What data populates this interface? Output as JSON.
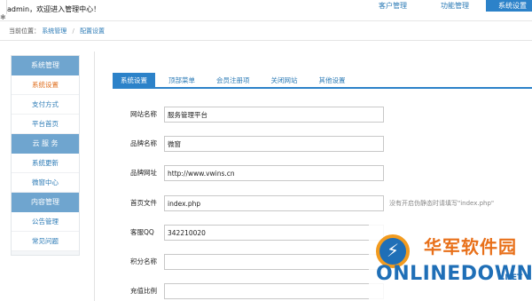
{
  "header": {
    "welcome": "admin，欢迎进入管理中心！",
    "nav": [
      "客户管理",
      "功能管理",
      "系统设置"
    ]
  },
  "breadcrumb": {
    "prefix": "当前位置：",
    "items": [
      "系统管理",
      "配置设置"
    ],
    "sep": "/"
  },
  "sidebar": {
    "sections": [
      {
        "title": "系统管理",
        "items": [
          "系统设置",
          "支付方式",
          "平台首页"
        ]
      },
      {
        "title": "云 服 务",
        "items": [
          "系统更新",
          "微窗中心"
        ]
      },
      {
        "title": "内容管理",
        "items": [
          "公告管理",
          "常见问题"
        ]
      }
    ],
    "active": "系统设置"
  },
  "tabs": [
    "系统设置",
    "顶部菜单",
    "会员注册项",
    "关闭网站",
    "其他设置"
  ],
  "form": {
    "rows": [
      {
        "label": "网站名称",
        "value": "服务管理平台",
        "hint": ""
      },
      {
        "label": "品牌名称",
        "value": "微窗",
        "hint": ""
      },
      {
        "label": "品牌网址",
        "value": "http://www.vwins.cn",
        "hint": ""
      },
      {
        "label": "首页文件",
        "value": "index.php",
        "hint": "没有开启伪静态时请填写\"index.php\""
      },
      {
        "label": "客服QQ",
        "value": "342210020",
        "hint": ""
      },
      {
        "label": "积分名称",
        "value": "",
        "hint": ""
      },
      {
        "label": "充值比例",
        "value": "",
        "hint": ""
      }
    ]
  },
  "watermark": {
    "cn": "华军软件园",
    "en": "ONLINEDOWN",
    "net": ".NET"
  },
  "colors": {
    "accent": "#2c82c9",
    "sidebar_head": "#6fa5cf",
    "active_item": "#e07020"
  }
}
